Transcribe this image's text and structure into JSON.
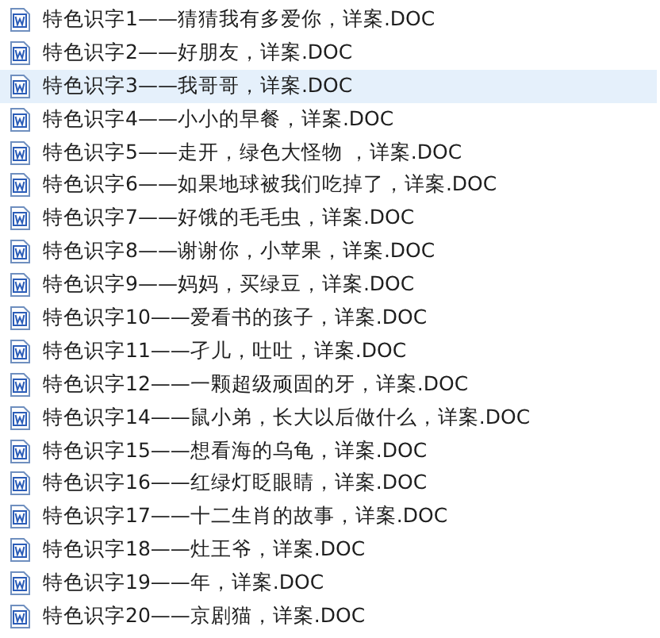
{
  "files": [
    {
      "name": "特色识字1——猜猜我有多爱你，详案.DOC",
      "selected": false
    },
    {
      "name": "特色识字2——好朋友，详案.DOC",
      "selected": false
    },
    {
      "name": "特色识字3——我哥哥，详案.DOC",
      "selected": true
    },
    {
      "name": "特色识字4——小小的早餐，详案.DOC",
      "selected": false
    },
    {
      "name": "特色识字5——走开，绿色大怪物 ，详案.DOC",
      "selected": false
    },
    {
      "name": "特色识字6——如果地球被我们吃掉了，详案.DOC",
      "selected": false
    },
    {
      "name": "特色识字7——好饿的毛毛虫，详案.DOC",
      "selected": false
    },
    {
      "name": "特色识字8——谢谢你，小苹果，详案.DOC",
      "selected": false
    },
    {
      "name": "特色识字9——妈妈，买绿豆，详案.DOC",
      "selected": false
    },
    {
      "name": "特色识字10——爱看书的孩子，详案.DOC",
      "selected": false
    },
    {
      "name": "特色识字11——孑儿，吐吐，详案.DOC",
      "selected": false
    },
    {
      "name": "特色识字12——一颗超级顽固的牙，详案.DOC",
      "selected": false
    },
    {
      "name": "特色识字14——鼠小弟，长大以后做什么，详案.DOC",
      "selected": false
    },
    {
      "name": "特色识字15——想看海的乌龟，详案.DOC",
      "selected": false
    },
    {
      "name": "特色识字16——红绿灯眨眼睛，详案.DOC",
      "selected": false
    },
    {
      "name": "特色识字17——十二生肖的故事，详案.DOC",
      "selected": false
    },
    {
      "name": "特色识字18——灶王爷，详案.DOC",
      "selected": false
    },
    {
      "name": "特色识字19——年，详案.DOC",
      "selected": false
    },
    {
      "name": "特色识字20——京剧猫，详案.DOC",
      "selected": false
    }
  ]
}
